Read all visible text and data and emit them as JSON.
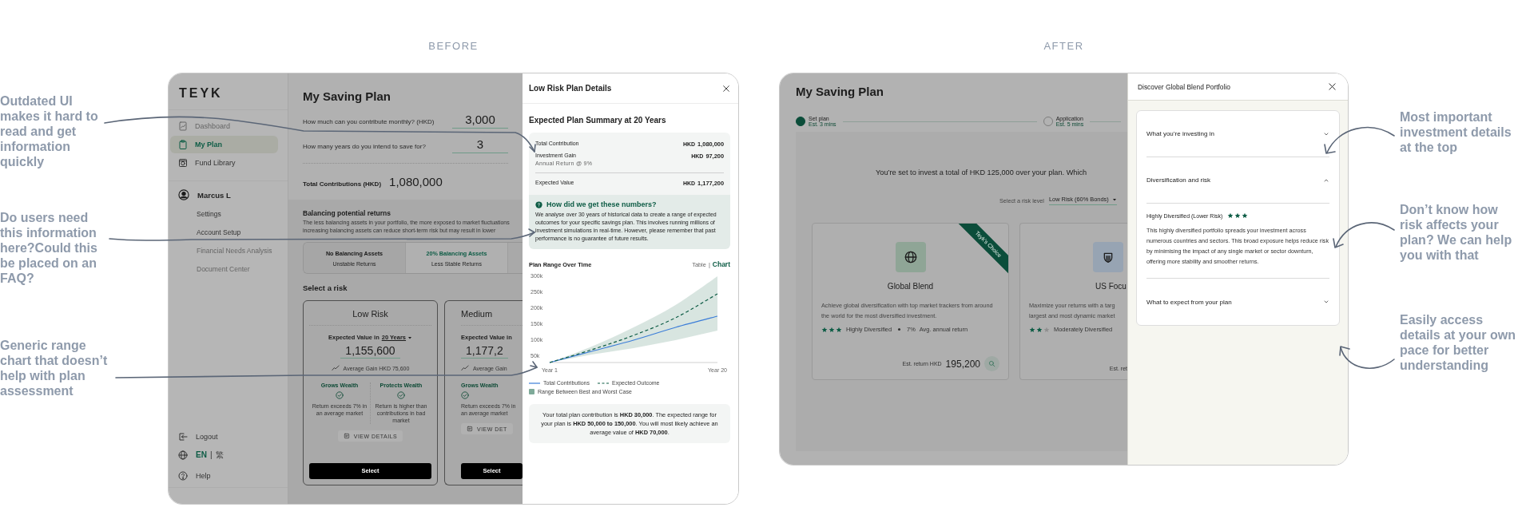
{
  "annotations_left": [
    "Outdated UI makes it hard to read and get information quickly",
    "Do users need this information here?Could this be placed on an FAQ?",
    "Generic range chart that doesn’t help with plan assessment"
  ],
  "before": {
    "heading": "BEFORE",
    "sidebar": {
      "logo": "TEYK",
      "nav": [
        {
          "label": "Dashboard",
          "selected": false,
          "disabled": true
        },
        {
          "label": "My Plan",
          "selected": true,
          "disabled": false
        },
        {
          "label": "Fund Library",
          "selected": false,
          "disabled": false
        }
      ],
      "user": "Marcus L",
      "account": [
        {
          "label": "Settings",
          "disabled": false
        },
        {
          "label": "Account Setup",
          "disabled": false
        },
        {
          "label": "Financial Needs Analysis",
          "disabled": true
        },
        {
          "label": "Document Center",
          "disabled": true
        }
      ],
      "logout": "Logout",
      "languages": [
        {
          "label": "EN",
          "selected": true
        },
        {
          "label": "繁",
          "selected": false
        }
      ],
      "language_separator": "|",
      "help": "Help"
    },
    "main": {
      "title": "My Saving Plan",
      "questions": [
        {
          "label": "How much can you contribute monthly? (HKD)",
          "value": "3,000"
        },
        {
          "label": "How many years do you intend to save for?",
          "value": "3"
        }
      ],
      "total": {
        "label": "Total Contributions (HKD)",
        "value": "1,080,000"
      },
      "balancing": {
        "title": "Balancing potential returns",
        "text": "The less balancing assets in your portfolio, the more exposed to market fluctuations increasing balancing assets can reduce short-term risk but may result in lower",
        "options": [
          {
            "label": "No Balancing Assets",
            "sub": "Unstable Returns",
            "selected": false
          },
          {
            "label": "20% Balancing Assets",
            "sub": "Less Stable Returns",
            "selected": true
          }
        ]
      },
      "risk_title": "Select a risk",
      "cards": [
        {
          "title": "Low Risk",
          "expected_label": "Expected Value in",
          "period": "20 Years",
          "value": "1,155,600",
          "gain": "Average Gain HKD 75,600",
          "features": [
            {
              "title": "Grows Wealth",
              "text": "Return exceeds 7% in an average market"
            },
            {
              "title": "Protects Wealth",
              "text": "Return is higher than contributions in bad market"
            }
          ],
          "details": "VIEW DETAILS",
          "select": "Select"
        },
        {
          "title": "Medium",
          "expected_label": "Expected Value in",
          "value": "1,177,2",
          "gain": "Average Gain",
          "features": [
            {
              "title": "Grows Wealth",
              "text": "Return exceeds 7% in an average market"
            }
          ],
          "details": "VIEW DET",
          "select": "Select"
        }
      ]
    },
    "panel": {
      "title": "Low Risk Plan Details",
      "summary_title": "Expected Plan Summary at 20 Years",
      "rows": [
        {
          "kind": "item",
          "label": "Total Contribution",
          "currency": "HKD",
          "value": "1,080,000"
        },
        {
          "kind": "item",
          "label": "Investment Gain",
          "note": "Annual Return @ 9%",
          "currency": "HKD",
          "value": "97,200"
        },
        {
          "kind": "total",
          "label": "Expected Value",
          "currency": "HKD",
          "value": "1,177,200"
        }
      ],
      "info": {
        "title": "How did we get these numbers?",
        "text": "We analyse over 30 years of historical data to create a range of expected outcomes for your specific savings plan. This involves running millions of investment simulations in real-time. However, please remember that past performance is no guarantee of future results."
      },
      "chart_title": "Plan Range Over Time",
      "views": [
        {
          "label": "Table",
          "selected": false
        },
        {
          "label": "Chart",
          "selected": true
        }
      ],
      "view_separator": "|",
      "chart_data": {
        "type": "line",
        "categories": [
          "Year 1",
          null,
          null,
          null,
          "Year 20"
        ],
        "ylim": [
          30000,
          300000
        ],
        "yticks": [
          {
            "value": 50000,
            "label": "50k"
          },
          {
            "value": 100000,
            "label": "100k"
          },
          {
            "value": 150000,
            "label": "150k"
          },
          {
            "value": 200000,
            "label": "200k"
          },
          {
            "value": 250000,
            "label": "250k"
          },
          {
            "value": 300000,
            "label": "300k"
          }
        ],
        "series": [
          {
            "name": "Total Contributions",
            "color": "#3b7dd8",
            "line_style": "solid",
            "values": [
              30000,
              65000,
              100000,
              140000,
              175000
            ]
          },
          {
            "name": "Expected Outcome",
            "color": "#0d5c45",
            "line_style": "dashed",
            "values": [
              30000,
              70000,
              115000,
              170000,
              245000
            ],
            "lower": [
              30000,
              55000,
              75000,
              100000,
              130000
            ],
            "upper": [
              30000,
              80000,
              140000,
              210000,
              300000
            ]
          }
        ]
      },
      "range_legend": {
        "label": "Range Between Best and Worst Case",
        "color": "#7faa99"
      },
      "conclusion": "Your total plan contribution is **HKD 30,000**. The expected range for your plan is **HKD 50,000 to 150,000**. You will most likely achieve an average value of **HKD 70,000**."
    }
  },
  "after": {
    "heading": "AFTER",
    "main": {
      "title": "My Saving Plan",
      "steps": [
        {
          "label": "Set plan",
          "sub": "Est. 3 mins",
          "selected": true
        },
        {
          "label": "Application",
          "sub": "Est. 5 mins",
          "selected": false
        }
      ],
      "intro": "You’re set to invest a total of HKD 125,000 over your plan. Which",
      "risk_label": "Select a risk level",
      "risk_value": "Low Risk (60% Bonds)",
      "cards": [
        {
          "title": "Global Blend",
          "ribbon": "Teyk’s Choice",
          "description": "Achieve global diversification with top market trackers from around the world for the most diversified investment.",
          "stars": 3,
          "diversification": "Highly Diversified",
          "return_value": "7%",
          "return_label": "Avg. annual return",
          "est_label": "Est. return HKD",
          "est_value": "195,200"
        },
        {
          "title": "US Focu",
          "description_lines": [
            "Maximize your returns with a targ",
            "largest and most dynamic market"
          ],
          "stars": 2,
          "diversification": "Moderately Diversified",
          "est_label": "Est. ret"
        }
      ]
    },
    "panel": {
      "title": "Discover Global Blend Portfolio",
      "sections": [
        {
          "title": "What you’re investing in",
          "expanded": false
        },
        {
          "title": "Diversification and risk",
          "expanded": true,
          "heading": "Highly Diversified (Lower Risk)",
          "stars": 3,
          "text": "This highly diversified portfolio spreads your investment across numerous countries and sectors. This broad exposure helps reduce risk by minimising the impact of any single market or sector downturn, offering more stability and smoother returns."
        },
        {
          "title": "What to expect from your plan",
          "expanded": false
        }
      ]
    }
  },
  "annotations_right": [
    "Most important investment details at the top",
    "Don’t know how risk affects your plan? We can help you with that",
    "Easily access details at your own pace for better understanding"
  ]
}
